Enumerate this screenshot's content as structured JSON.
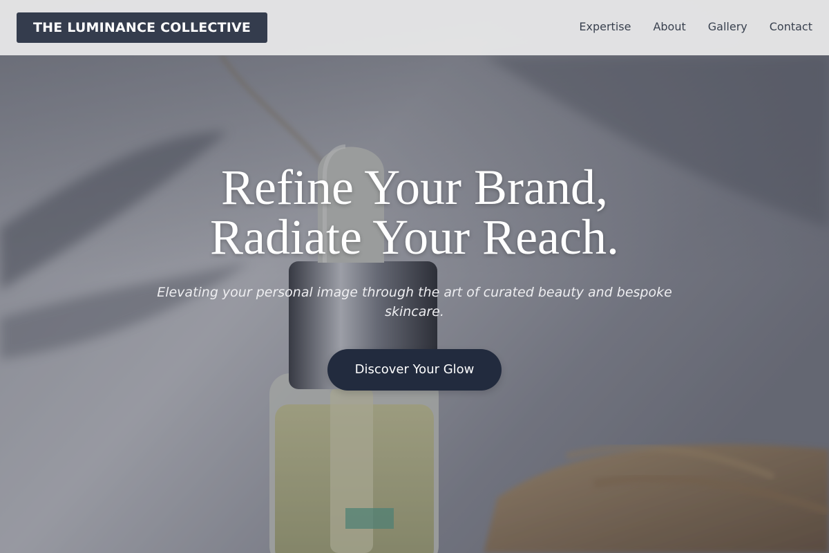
{
  "header": {
    "logo_text": "THE LUMINANCE COLLECTIVE",
    "nav": [
      {
        "label": "Expertise"
      },
      {
        "label": "About"
      },
      {
        "label": "Gallery"
      },
      {
        "label": "Contact"
      }
    ]
  },
  "hero": {
    "title_line1": "Refine Your Brand,",
    "title_line2": "Radiate Your Reach.",
    "subtitle": "Elevating your personal image through the art of curated beauty and bespoke skincare.",
    "cta_label": "Discover Your Glow",
    "background_image": "serum-dropper-bottle-with-dried-grass"
  },
  "colors": {
    "header_bg": "#e6e6e7",
    "logo_bg": "#343c4d",
    "nav_text": "#39414f",
    "cta_bg": "#222b3e",
    "hero_text": "#ffffff"
  }
}
